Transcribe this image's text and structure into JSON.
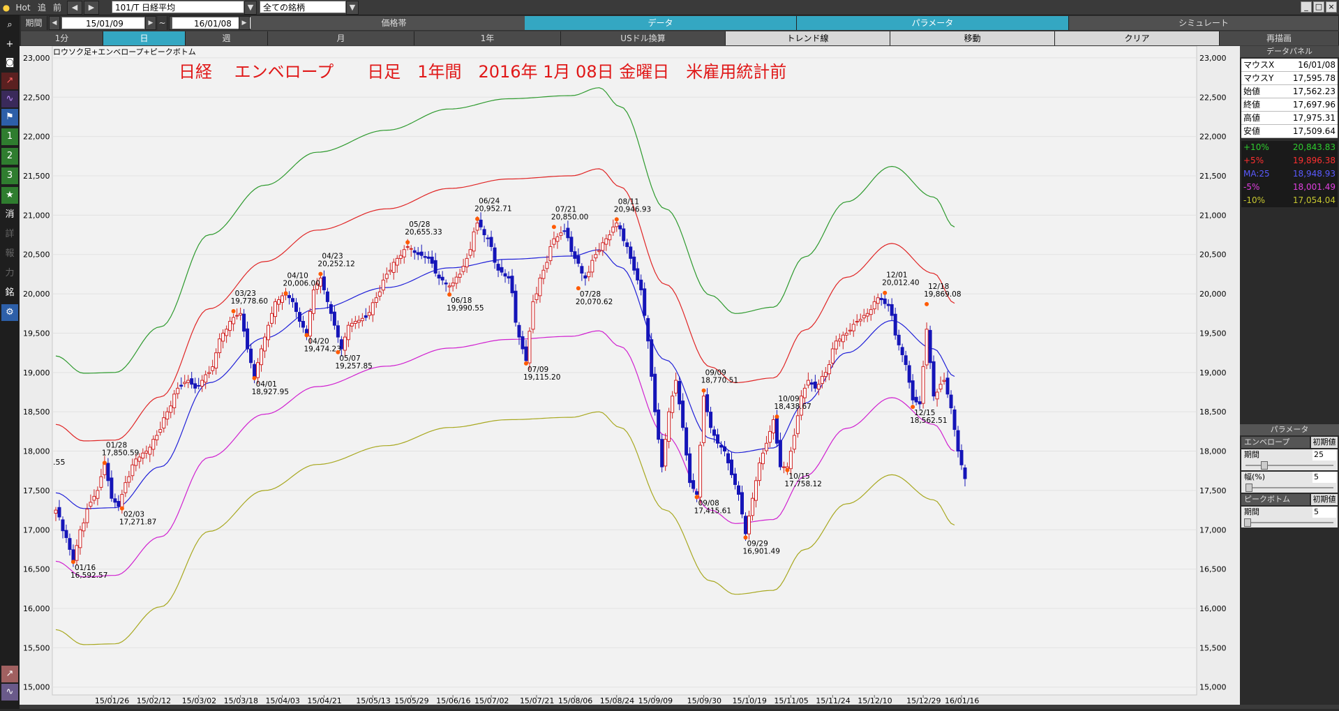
{
  "toolbar": {
    "hot": "Hot",
    "tsui": "追",
    "mae": "前",
    "symbol": "101/T 日経平均",
    "filter": "全ての銘柄",
    "kikan": "期間",
    "date_from": "15/01/09",
    "tilde": "~",
    "date_to": "16/01/08"
  },
  "row2": {
    "price": "価格帯",
    "data": "データ",
    "param": "パラメータ",
    "sim": "シミュレート"
  },
  "row3": {
    "m1": "1分",
    "day": "日",
    "week": "週",
    "month": "月",
    "year": "1年",
    "usd": "USドル換算",
    "trend": "トレンド線",
    "move": "移動",
    "clear": "クリア",
    "redraw": "再描画"
  },
  "left_tools": {
    "t1": "1",
    "t2": "2",
    "t3": "3",
    "t4": "★",
    "t5": "消",
    "t6": "詳",
    "t7": "報",
    "t8": "力",
    "t9": "銘"
  },
  "chart_data": {
    "type": "line",
    "chart_label": "ロウソク足+エンベロープ+ピークボトム",
    "title": "日経　 エンベロープ　　日足　1年間　2016年 1月 08日 金曜日　米雇用統計前",
    "left_fragment": ".55",
    "ylim": [
      14900,
      23150
    ],
    "y_ticks": [
      15000,
      15500,
      16000,
      16500,
      17000,
      17500,
      18000,
      18500,
      19000,
      19500,
      20000,
      20500,
      21000,
      21500,
      22000,
      22500,
      23000
    ],
    "x_ticks": [
      "15/01/26",
      "15/02/12",
      "15/03/02",
      "15/03/18",
      "15/04/03",
      "15/04/21",
      "15/05/13",
      "15/05/29",
      "15/06/16",
      "15/07/02",
      "15/07/21",
      "15/08/06",
      "15/08/24",
      "15/09/09",
      "15/09/30",
      "15/10/19",
      "15/11/05",
      "15/11/24",
      "15/12/10",
      "15/12/29",
      "16/01/16"
    ],
    "x_tick_index": [
      16,
      28,
      41,
      53,
      65,
      77,
      91,
      102,
      114,
      125,
      138,
      149,
      161,
      172,
      186,
      199,
      211,
      223,
      235,
      249,
      260
    ],
    "n_points": 244,
    "series": [
      {
        "name": "+10%",
        "color": "#2e9a2e",
        "keypoints": [
          [
            0,
            19210
          ],
          [
            8,
            18990
          ],
          [
            17,
            19000
          ],
          [
            30,
            19580
          ],
          [
            44,
            20750
          ],
          [
            60,
            21380
          ],
          [
            75,
            21800
          ],
          [
            95,
            22080
          ],
          [
            113,
            22350
          ],
          [
            130,
            22480
          ],
          [
            148,
            22520
          ],
          [
            156,
            22620
          ],
          [
            162,
            22380
          ],
          [
            175,
            21080
          ],
          [
            188,
            19980
          ],
          [
            195,
            19750
          ],
          [
            206,
            19830
          ],
          [
            215,
            20470
          ],
          [
            227,
            21170
          ],
          [
            240,
            21620
          ],
          [
            252,
            21230
          ],
          [
            258,
            20850
          ]
        ]
      },
      {
        "name": "+5%",
        "color": "#e02525",
        "keypoints": [
          [
            0,
            18340
          ],
          [
            8,
            18130
          ],
          [
            17,
            18140
          ],
          [
            30,
            18690
          ],
          [
            44,
            19810
          ],
          [
            60,
            20410
          ],
          [
            75,
            20810
          ],
          [
            95,
            21080
          ],
          [
            113,
            21340
          ],
          [
            130,
            21460
          ],
          [
            148,
            21500
          ],
          [
            156,
            21590
          ],
          [
            162,
            21360
          ],
          [
            175,
            20120
          ],
          [
            188,
            19070
          ],
          [
            195,
            18870
          ],
          [
            206,
            18930
          ],
          [
            215,
            19540
          ],
          [
            227,
            20210
          ],
          [
            240,
            20640
          ],
          [
            252,
            20260
          ],
          [
            258,
            19880
          ]
        ]
      },
      {
        "name": "MA:25",
        "color": "#2020d8",
        "keypoints": [
          [
            0,
            17470
          ],
          [
            8,
            17270
          ],
          [
            17,
            17280
          ],
          [
            30,
            17800
          ],
          [
            44,
            18870
          ],
          [
            60,
            19440
          ],
          [
            75,
            19810
          ],
          [
            95,
            20080
          ],
          [
            113,
            20330
          ],
          [
            130,
            20440
          ],
          [
            148,
            20480
          ],
          [
            156,
            20560
          ],
          [
            162,
            20340
          ],
          [
            175,
            19160
          ],
          [
            188,
            18160
          ],
          [
            195,
            17980
          ],
          [
            206,
            18040
          ],
          [
            215,
            18610
          ],
          [
            227,
            19250
          ],
          [
            240,
            19660
          ],
          [
            252,
            19300
          ],
          [
            258,
            18950
          ]
        ]
      },
      {
        "name": "-5%",
        "color": "#d020d0",
        "keypoints": [
          [
            0,
            16600
          ],
          [
            8,
            16400
          ],
          [
            17,
            16420
          ],
          [
            30,
            16910
          ],
          [
            44,
            17920
          ],
          [
            60,
            18470
          ],
          [
            75,
            18820
          ],
          [
            95,
            19080
          ],
          [
            113,
            19310
          ],
          [
            130,
            19420
          ],
          [
            148,
            19460
          ],
          [
            156,
            19530
          ],
          [
            162,
            19330
          ],
          [
            175,
            18200
          ],
          [
            188,
            17250
          ],
          [
            195,
            17080
          ],
          [
            206,
            17130
          ],
          [
            215,
            17680
          ],
          [
            227,
            18290
          ],
          [
            240,
            18680
          ],
          [
            252,
            18340
          ],
          [
            258,
            18000
          ]
        ]
      },
      {
        "name": "-10%",
        "color": "#a8a820",
        "keypoints": [
          [
            0,
            15730
          ],
          [
            8,
            15540
          ],
          [
            17,
            15550
          ],
          [
            30,
            16020
          ],
          [
            44,
            16980
          ],
          [
            60,
            17500
          ],
          [
            75,
            17830
          ],
          [
            95,
            18070
          ],
          [
            113,
            18300
          ],
          [
            130,
            18400
          ],
          [
            148,
            18430
          ],
          [
            156,
            18500
          ],
          [
            162,
            18300
          ],
          [
            175,
            17250
          ],
          [
            188,
            16350
          ],
          [
            195,
            16180
          ],
          [
            206,
            16230
          ],
          [
            215,
            16750
          ],
          [
            227,
            17330
          ],
          [
            240,
            17700
          ],
          [
            252,
            17380
          ],
          [
            258,
            17060
          ]
        ]
      }
    ],
    "price_keypoints": [
      [
        0,
        17250
      ],
      [
        3,
        16900
      ],
      [
        5,
        16600
      ],
      [
        7,
        17000
      ],
      [
        10,
        17350
      ],
      [
        12,
        17500
      ],
      [
        14,
        17850
      ],
      [
        16,
        17400
      ],
      [
        18,
        17300
      ],
      [
        20,
        17600
      ],
      [
        23,
        17900
      ],
      [
        26,
        18000
      ],
      [
        29,
        18200
      ],
      [
        32,
        18500
      ],
      [
        35,
        18800
      ],
      [
        38,
        18900
      ],
      [
        40,
        18800
      ],
      [
        44,
        19000
      ],
      [
        48,
        19500
      ],
      [
        51,
        19700
      ],
      [
        53,
        19750
      ],
      [
        55,
        19300
      ],
      [
        57,
        18950
      ],
      [
        59,
        19300
      ],
      [
        61,
        19600
      ],
      [
        63,
        19900
      ],
      [
        66,
        20000
      ],
      [
        68,
        19900
      ],
      [
        70,
        19650
      ],
      [
        72,
        19500
      ],
      [
        74,
        20050
      ],
      [
        76,
        20200
      ],
      [
        78,
        19900
      ],
      [
        80,
        19600
      ],
      [
        82,
        19300
      ],
      [
        84,
        19600
      ],
      [
        86,
        19650
      ],
      [
        89,
        19700
      ],
      [
        92,
        19950
      ],
      [
        95,
        20250
      ],
      [
        98,
        20450
      ],
      [
        101,
        20600
      ],
      [
        104,
        20500
      ],
      [
        107,
        20450
      ],
      [
        110,
        20200
      ],
      [
        113,
        20100
      ],
      [
        116,
        20250
      ],
      [
        118,
        20450
      ],
      [
        121,
        20900
      ],
      [
        124,
        20700
      ],
      [
        127,
        20300
      ],
      [
        130,
        20200
      ],
      [
        133,
        19450
      ],
      [
        135,
        19150
      ],
      [
        137,
        19900
      ],
      [
        140,
        20300
      ],
      [
        143,
        20700
      ],
      [
        146,
        20800
      ],
      [
        149,
        20450
      ],
      [
        152,
        20200
      ],
      [
        155,
        20500
      ],
      [
        158,
        20700
      ],
      [
        161,
        20900
      ],
      [
        164,
        20600
      ],
      [
        166,
        20300
      ],
      [
        168,
        20050
      ],
      [
        170,
        19400
      ],
      [
        172,
        18500
      ],
      [
        174,
        17800
      ],
      [
        176,
        18500
      ],
      [
        178,
        18900
      ],
      [
        180,
        18300
      ],
      [
        182,
        17600
      ],
      [
        184,
        17450
      ],
      [
        186,
        18700
      ],
      [
        188,
        18300
      ],
      [
        190,
        18100
      ],
      [
        192,
        18000
      ],
      [
        194,
        17700
      ],
      [
        196,
        17450
      ],
      [
        198,
        16950
      ],
      [
        200,
        17400
      ],
      [
        202,
        17850
      ],
      [
        204,
        18100
      ],
      [
        206,
        18400
      ],
      [
        208,
        17800
      ],
      [
        210,
        17800
      ],
      [
        212,
        18200
      ],
      [
        214,
        18700
      ],
      [
        216,
        18900
      ],
      [
        218,
        18800
      ],
      [
        221,
        19000
      ],
      [
        224,
        19400
      ],
      [
        227,
        19500
      ],
      [
        230,
        19650
      ],
      [
        233,
        19750
      ],
      [
        236,
        19950
      ],
      [
        239,
        19850
      ],
      [
        242,
        19350
      ],
      [
        244,
        19100
      ],
      [
        246,
        18650
      ],
      [
        248,
        18600
      ],
      [
        250,
        19550
      ],
      [
        252,
        18700
      ],
      [
        255,
        18900
      ],
      [
        257,
        18550
      ],
      [
        259,
        18000
      ],
      [
        261,
        17650
      ]
    ],
    "peaks": [
      {
        "i": 5,
        "date": "01/16",
        "value": "16,592.57",
        "type": "bottom"
      },
      {
        "i": 14,
        "date": "01/28",
        "value": "17,850.59",
        "type": "peak"
      },
      {
        "i": 19,
        "date": "02/03",
        "value": "17,271.87",
        "type": "bottom"
      },
      {
        "i": 51,
        "date": "03/23",
        "value": "19,778.60",
        "type": "peak"
      },
      {
        "i": 57,
        "date": "04/01",
        "value": "18,927.95",
        "type": "bottom"
      },
      {
        "i": 66,
        "date": "04/10",
        "value": "20,006.00",
        "type": "peak"
      },
      {
        "i": 72,
        "date": "04/20",
        "value": "19,474.23",
        "type": "bottom"
      },
      {
        "i": 76,
        "date": "04/23",
        "value": "20,252.12",
        "type": "peak"
      },
      {
        "i": 81,
        "date": "05/07",
        "value": "19,257.85",
        "type": "bottom"
      },
      {
        "i": 101,
        "date": "05/28",
        "value": "20,655.33",
        "type": "peak"
      },
      {
        "i": 113,
        "date": "06/18",
        "value": "19,990.55",
        "type": "bottom"
      },
      {
        "i": 121,
        "date": "06/24",
        "value": "20,952.71",
        "type": "peak"
      },
      {
        "i": 135,
        "date": "07/09",
        "value": "19,115.20",
        "type": "bottom"
      },
      {
        "i": 143,
        "date": "07/21",
        "value": "20,850.00",
        "type": "peak"
      },
      {
        "i": 150,
        "date": "07/28",
        "value": "20,070.62",
        "type": "bottom"
      },
      {
        "i": 161,
        "date": "08/11",
        "value": "20,946.93",
        "type": "peak"
      },
      {
        "i": 184,
        "date": "09/08",
        "value": "17,415.61",
        "type": "bottom"
      },
      {
        "i": 186,
        "date": "09/09",
        "value": "18,770.51",
        "type": "peak"
      },
      {
        "i": 198,
        "date": "09/29",
        "value": "16,901.49",
        "type": "bottom"
      },
      {
        "i": 207,
        "date": "10/09",
        "value": "18,438.67",
        "type": "peak"
      },
      {
        "i": 210,
        "date": "10/15",
        "value": "17,758.12",
        "type": "bottom"
      },
      {
        "i": 238,
        "date": "12/01",
        "value": "20,012.40",
        "type": "peak"
      },
      {
        "i": 246,
        "date": "12/15",
        "value": "18,562.51",
        "type": "bottom"
      },
      {
        "i": 250,
        "date": "12/18",
        "value": "19,869.08",
        "type": "peak"
      }
    ]
  },
  "data_panel": {
    "title": "データパネル",
    "rows": [
      {
        "k": "マウスX",
        "v": "16/01/08"
      },
      {
        "k": "マウスY",
        "v": "17,595.78"
      },
      {
        "k": "始値",
        "v": "17,562.23"
      },
      {
        "k": "終値",
        "v": "17,697.96"
      },
      {
        "k": "高値",
        "v": "17,975.31"
      },
      {
        "k": "安値",
        "v": "17,509.64"
      }
    ],
    "env": [
      {
        "k": "+10%",
        "v": "20,843.83",
        "color": "#2ecc2e"
      },
      {
        "k": "+5%",
        "v": "19,896.38",
        "color": "#ff3030"
      },
      {
        "k": "MA:25",
        "v": "18,948.93",
        "color": "#5a5aff"
      },
      {
        "k": "-5%",
        "v": "18,001.49",
        "color": "#e040e0"
      },
      {
        "k": "-10%",
        "v": "17,054.04",
        "color": "#c8c830"
      }
    ]
  },
  "param_panel": {
    "title": "パラメータ",
    "envelope": "エンベロープ",
    "init1": "初期値",
    "period_label": "期間",
    "period_value": "25",
    "width_label": "幅(%)",
    "width_value": "5",
    "peak": "ピークボトム",
    "init2": "初期値",
    "period2_label": "期間",
    "period2_value": "5"
  }
}
